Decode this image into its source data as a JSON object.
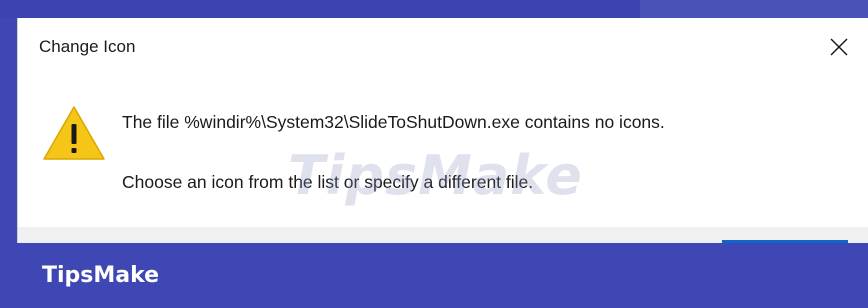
{
  "dialog": {
    "title": "Change Icon",
    "close_icon": "close-icon",
    "warning_icon": "warning-icon",
    "message_line1": "The file %windir%\\System32\\SlideToShutDown.exe contains no icons.",
    "message_line2": "Choose an icon from the list or specify a different file."
  },
  "watermark": {
    "text": "TipsMake"
  },
  "branding": {
    "text": "TipsMake"
  },
  "colors": {
    "background": "#3e47b3",
    "warning": "#f5c518",
    "accent": "#0f66c9"
  }
}
